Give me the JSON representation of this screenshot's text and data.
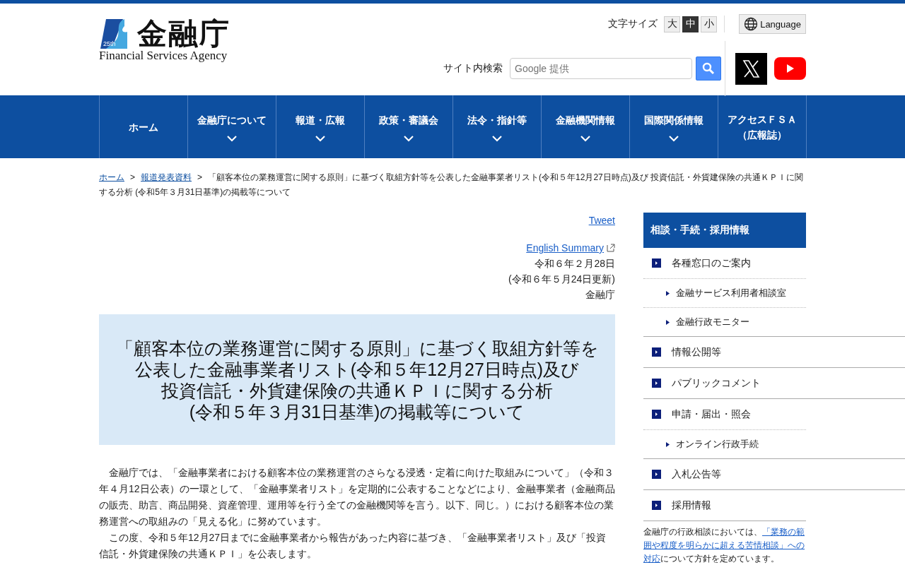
{
  "header": {
    "logo": {
      "title": "金融庁",
      "subtitle": "Financial Services Agency",
      "badge": "25th"
    },
    "font_size": {
      "label": "文字サイズ",
      "options": [
        {
          "label": "大",
          "selected": false
        },
        {
          "label": "中",
          "selected": true
        },
        {
          "label": "小",
          "selected": false
        }
      ]
    },
    "language_button": "Language",
    "search": {
      "label": "サイト内検索",
      "placeholder": "Google 提供"
    }
  },
  "nav": [
    {
      "label": "ホーム",
      "has_menu": false
    },
    {
      "label": "金融庁について",
      "has_menu": true
    },
    {
      "label": "報道・広報",
      "has_menu": true
    },
    {
      "label": "政策・審議会",
      "has_menu": true
    },
    {
      "label": "法令・指針等",
      "has_menu": true
    },
    {
      "label": "金融機関情報",
      "has_menu": true
    },
    {
      "label": "国際関係情報",
      "has_menu": true
    },
    {
      "label": [
        "アクセスＦＳＡ",
        "（広報誌）"
      ],
      "has_menu": false
    }
  ],
  "breadcrumb": {
    "links": [
      "ホーム",
      "報道発表資料"
    ],
    "separators": [
      ">",
      ">"
    ],
    "current": "「顧客本位の業務運営に関する原則」に基づく取組方針等を公表した金融事業者リスト(令和５年12月27日時点)及び 投資信託・外貨建保険の共通ＫＰＩに関する分析 (令和5年３月31日基準)の掲載等について"
  },
  "article": {
    "tweet": "Tweet",
    "english_summary": "English Summary",
    "date": "令和６年２月28日",
    "updated": "(令和６年５月24日更新)",
    "publisher": "金融庁",
    "title": [
      "「顧客本位の業務運営に関する原則」に基づく取組方針等を",
      "公表した金融事業者リスト(令和５年12月27日時点)及び",
      "投資信託・外貨建保険の共通ＫＰＩに関する分析",
      "(令和５年３月31日基準)の掲載等について"
    ],
    "paragraphs": [
      "金融庁では、「金融事業者における顧客本位の業務運営のさらなる浸透・定着に向けた取組みについて」（令和３年４月12日公表）の一環として、「金融事業者リスト」を定期的に公表することなどにより、金融事業者（金融商品の販売、助言、商品開発、資産管理、運用等を行う全ての金融機関等を言う。以下、同じ。）における顧客本位の業務運営への取組みの「見える化」に努めています。",
      "この度、令和５年12月27日までに金融事業者から報告があった内容に基づき、「金融事業者リスト」及び「投資信託・外貨建保険の共通ＫＰＩ」を公表します。"
    ]
  },
  "sidebar": {
    "heading": "相談・手続・採用情報",
    "items": [
      {
        "label": "各種窓口のご案内",
        "kind": "main"
      },
      {
        "label": "金融サービス利用者相談室",
        "kind": "sub"
      },
      {
        "label": "金融行政モニター",
        "kind": "sub"
      },
      {
        "label": "情報公開等",
        "kind": "main"
      },
      {
        "label": "パブリックコメント",
        "kind": "main"
      },
      {
        "label": "申請・届出・照会",
        "kind": "main"
      },
      {
        "label": "オンライン行政手続",
        "kind": "sub"
      },
      {
        "label": "入札公告等",
        "kind": "main"
      },
      {
        "label": "採用情報",
        "kind": "main"
      }
    ],
    "note": [
      [
        {
          "text": "金融庁の行政相談においては、",
          "kind": "text"
        },
        {
          "text": "「業務の範",
          "kind": "link"
        }
      ],
      [
        {
          "text": "囲や程度を明らかに超える苦情相談」への",
          "kind": "link"
        }
      ],
      [
        {
          "text": "対応",
          "kind": "link"
        },
        {
          "text": "について方針を定めています。",
          "kind": "text"
        }
      ]
    ]
  }
}
